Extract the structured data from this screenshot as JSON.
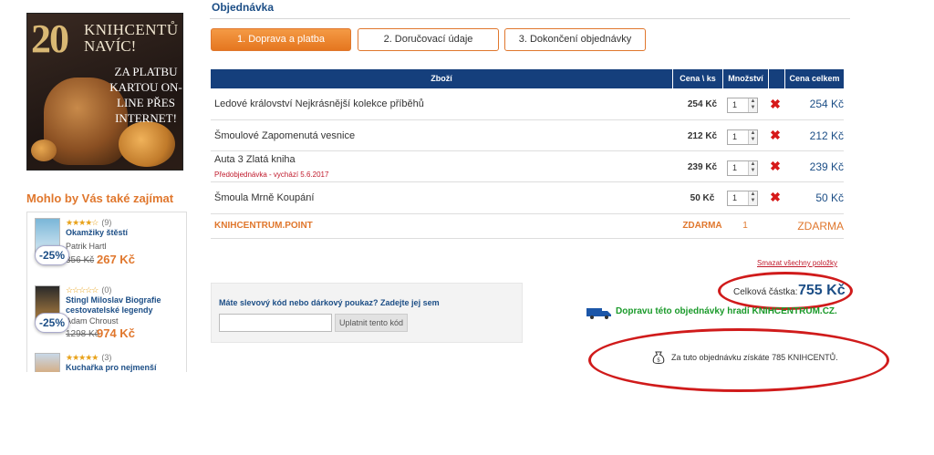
{
  "banner": {
    "number": "20",
    "line1": "KNIHCENTŮ",
    "line2": "NAVÍC!",
    "line3": "ZA PLATBU KARTOU ON-LINE PŘES INTERNET!"
  },
  "sidebar": {
    "title": "Mohlo by Vás také zajímat",
    "products": [
      {
        "stars": "★★★★☆",
        "count": "(9)",
        "title": "Okamžiky štěstí",
        "author": "Patrik Hartl",
        "old_price": "356 Kč",
        "price": "267 Kč",
        "discount": "-25%"
      },
      {
        "stars": "☆☆☆☆☆",
        "count": "(0)",
        "title": "Stingl Miloslav Biografie cestovatelské legendy",
        "author": "Adam Chroust",
        "old_price": "1298 Kč",
        "price": "974 Kč",
        "discount": "-25%"
      },
      {
        "stars": "★★★★★",
        "count": "(3)",
        "title": "Kuchařka pro nejmenší",
        "author": "",
        "old_price": "",
        "price": "",
        "discount": ""
      }
    ]
  },
  "main": {
    "heading": "Objednávka",
    "steps": [
      "1. Doprava a platba",
      "2. Doručovací údaje",
      "3. Dokončení objednávky"
    ],
    "columns": {
      "item": "Zboží",
      "unit": "Cena \\ ks",
      "qty": "Množství",
      "total": "Cena celkem"
    },
    "items": [
      {
        "name": "Ledové království Nejkrásnější kolekce příběhů",
        "preorder": "",
        "unit": "254 Kč",
        "qty": "1",
        "total": "254 Kč"
      },
      {
        "name": "Šmoulové Zapomenutá vesnice",
        "preorder": "",
        "unit": "212 Kč",
        "qty": "1",
        "total": "212 Kč"
      },
      {
        "name": "Auta 3 Zlatá kniha",
        "preorder": "Předobjednávka - vychází 5.6.2017",
        "unit": "239 Kč",
        "qty": "1",
        "total": "239 Kč"
      },
      {
        "name": "Šmoula Mrně Koupání",
        "preorder": "",
        "unit": "50 Kč",
        "qty": "1",
        "total": "50 Kč"
      }
    ],
    "shipping": {
      "name": "KNIHCENTRUM.POINT",
      "unit": "ZDARMA",
      "qty": "1",
      "total": "ZDARMA"
    },
    "clear_all": "Smazat všechny položky",
    "coupon": {
      "title": "Máte slevový kód nebo dárkový poukaz? Zadejte jej sem",
      "placeholder": "",
      "button": "Uplatnit tento kód"
    },
    "total_label": "Celková částka:",
    "total_value": "755 Kč",
    "free_shipping": "Dopravu této objednávky hradí KNIHCENTRUM.CZ.",
    "points": "Za tuto objednávku získáte 785 KNIHCENTŮ."
  },
  "colors": {
    "accent": "#e0772d",
    "brand": "#1c4e86",
    "header": "#153f7c",
    "annotation": "#d01b1b",
    "success": "#1a9a2a"
  }
}
